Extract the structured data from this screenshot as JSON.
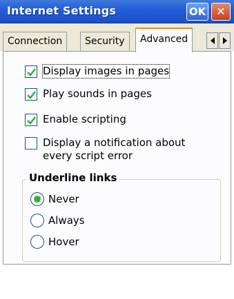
{
  "window": {
    "title": "Internet Settings",
    "ok_label": "OK",
    "close_label": "✕"
  },
  "tabs": [
    {
      "label": "Connection"
    },
    {
      "label": "Security"
    },
    {
      "label": "Advanced",
      "active": true
    }
  ],
  "tab_scroll": {
    "left_icon": "arrow-left-icon",
    "right_icon": "arrow-right-icon"
  },
  "options": [
    {
      "label": "Display images in pages",
      "checked": true
    },
    {
      "label": "Play sounds in pages",
      "checked": true
    },
    {
      "label": "Enable scripting",
      "checked": true
    },
    {
      "label": "Display a notification about every script error",
      "checked": false
    }
  ],
  "underline_links": {
    "title": "Underline links",
    "choices": [
      {
        "label": "Never",
        "selected": true
      },
      {
        "label": "Always",
        "selected": false
      },
      {
        "label": "Hover",
        "selected": false
      }
    ]
  },
  "colors": {
    "titlebar": "#245edb",
    "active_tab_accent": "#e68b2c",
    "radio_selected": "#2fb33c",
    "checkmark": "#2fb33c"
  }
}
